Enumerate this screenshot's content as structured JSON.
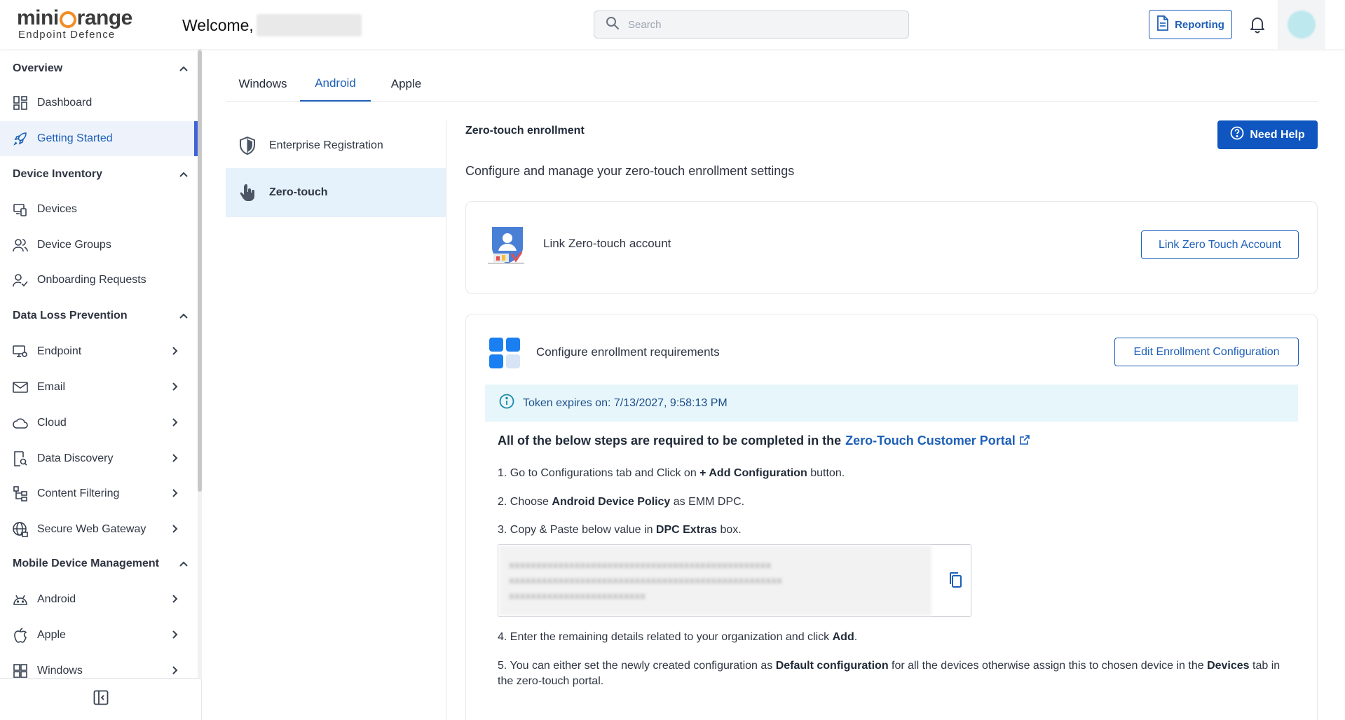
{
  "header": {
    "logo_main": "mini",
    "logo_main_2": "range",
    "logo_sub": "Endpoint Defence",
    "welcome": "Welcome,",
    "search_placeholder": "Search",
    "reporting_label": "Reporting"
  },
  "sidebar": {
    "sections": [
      {
        "label": "Overview",
        "items": [
          "Dashboard",
          "Getting Started"
        ]
      },
      {
        "label": "Device Inventory",
        "items": [
          "Devices",
          "Device Groups",
          "Onboarding Requests"
        ]
      },
      {
        "label": "Data Loss Prevention",
        "items": [
          "Endpoint",
          "Email",
          "Cloud",
          "Data Discovery",
          "Content Filtering",
          "Secure Web Gateway"
        ]
      },
      {
        "label": "Mobile Device Management",
        "items": [
          "Android",
          "Apple",
          "Windows"
        ]
      }
    ],
    "active_item": "Getting Started"
  },
  "tabs": [
    "Windows",
    "Android",
    "Apple"
  ],
  "active_tab": "Android",
  "subnav": [
    "Enterprise Registration",
    "Zero-touch"
  ],
  "active_subnav": "Zero-touch",
  "content": {
    "title": "Zero-touch enrollment",
    "subtitle": "Configure and manage your zero-touch enrollment settings",
    "need_help": "Need Help",
    "link_card": {
      "label": "Link Zero-touch account",
      "button": "Link Zero Touch Account"
    },
    "config_card": {
      "label": "Configure enrollment requirements",
      "button": "Edit Enrollment Configuration",
      "token": "Token expires on: 7/13/2027, 9:58:13 PM",
      "steps_heading": "All of the below steps are required to be completed in the",
      "portal_link": "Zero-Touch Customer Portal",
      "step1_a": "1. Go to Configurations tab and Click on ",
      "step1_b": "+ Add Configuration",
      "step1_c": " button.",
      "step2_a": "2. Choose ",
      "step2_b": "Android Device Policy",
      "step2_c": " as EMM DPC.",
      "step3_a": "3. Copy & Paste below value in ",
      "step3_b": "DPC Extras",
      "step3_c": " box.",
      "step4_a": "4. Enter the remaining details related to your organization and click ",
      "step4_b": "Add",
      "step4_c": ".",
      "step5_a": "5. You can either set the newly created configuration as ",
      "step5_b": "Default configuration",
      "step5_c": " for all the devices otherwise assign this to chosen device in the ",
      "step5_d": "Devices",
      "step5_e": " tab in the zero-touch portal."
    }
  },
  "colors": {
    "accent": "#1d5fb8",
    "primary_button": "#0f56c0",
    "active_bar": "#3f63d8",
    "info_bg": "#e7f6fb",
    "logo_orange": "#f28c28"
  }
}
